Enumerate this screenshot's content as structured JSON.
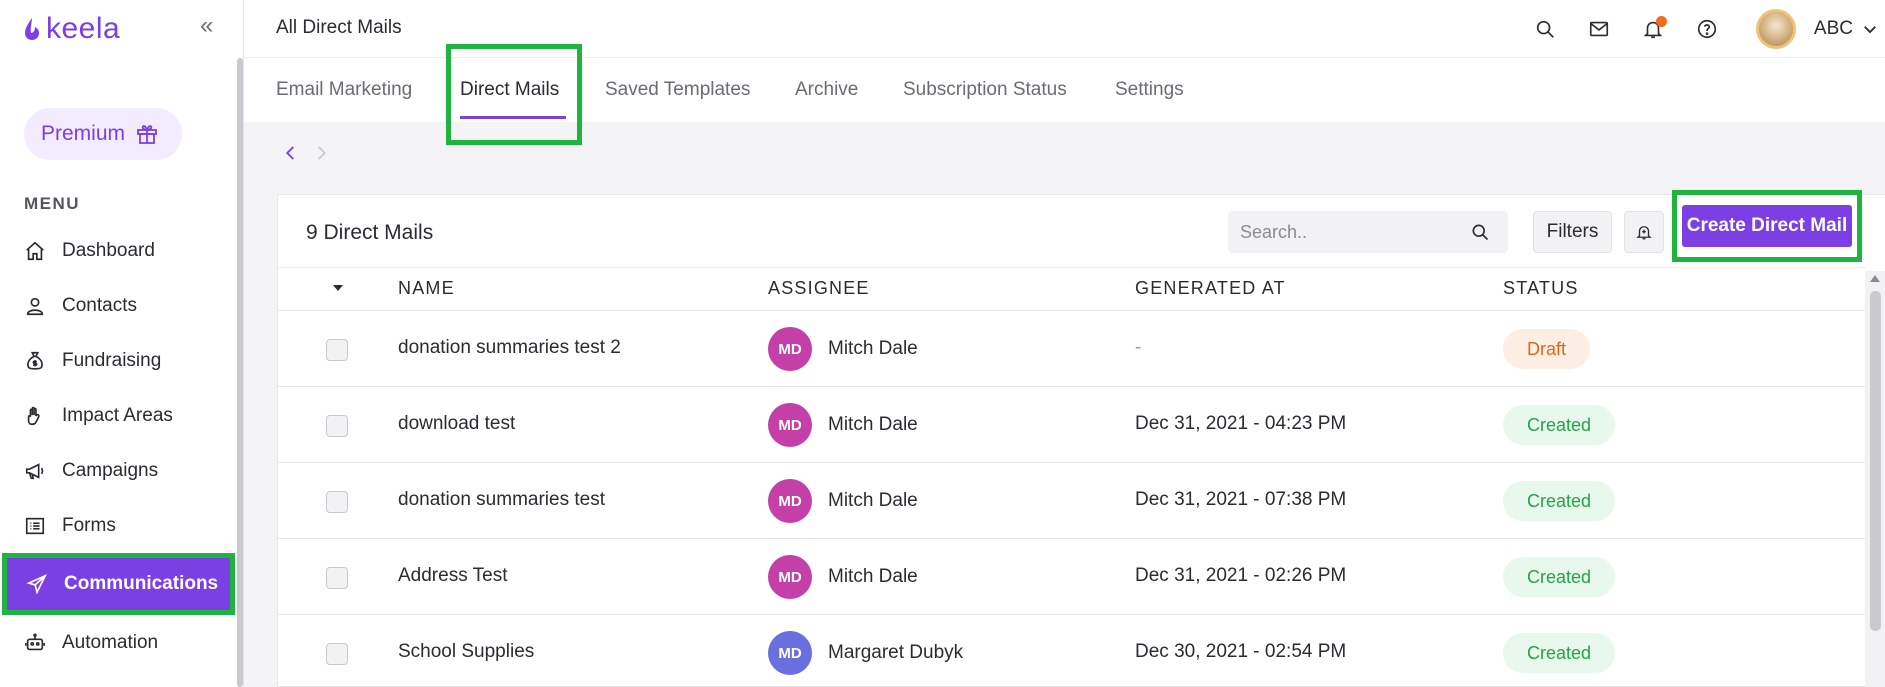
{
  "sidebar": {
    "logo_text": "keela",
    "premium_label": "Premium",
    "menu_title": "MENU",
    "items": [
      {
        "label": "Dashboard",
        "icon": "home-icon"
      },
      {
        "label": "Contacts",
        "icon": "user-icon"
      },
      {
        "label": "Fundraising",
        "icon": "money-bag-icon"
      },
      {
        "label": "Impact Areas",
        "icon": "hand-icon"
      },
      {
        "label": "Campaigns",
        "icon": "megaphone-icon"
      },
      {
        "label": "Forms",
        "icon": "form-icon"
      },
      {
        "label": "Communications",
        "icon": "paper-plane-icon",
        "active": true
      },
      {
        "label": "Automation",
        "icon": "robot-icon"
      }
    ]
  },
  "header": {
    "title": "All Direct Mails",
    "user_name": "ABC"
  },
  "tabs": [
    {
      "label": "Email Marketing"
    },
    {
      "label": "Direct Mails",
      "active": true
    },
    {
      "label": "Saved Templates"
    },
    {
      "label": "Archive"
    },
    {
      "label": "Subscription Status"
    },
    {
      "label": "Settings"
    }
  ],
  "card": {
    "title": "9 Direct Mails",
    "search_placeholder": "Search..",
    "filters_label": "Filters",
    "create_label": "Create Direct Mail"
  },
  "table": {
    "columns": [
      "NAME",
      "ASSIGNEE",
      "GENERATED AT",
      "STATUS"
    ],
    "rows": [
      {
        "name": "donation summaries test 2",
        "initials": "MD",
        "assignee": "Mitch Dale",
        "generated_at": "-",
        "status": "Draft"
      },
      {
        "name": "download test",
        "initials": "MD",
        "assignee": "Mitch Dale",
        "generated_at": "Dec 31, 2021 - 04:23 PM",
        "status": "Created"
      },
      {
        "name": "donation summaries test",
        "initials": "MD",
        "assignee": "Mitch Dale",
        "generated_at": "Dec 31, 2021 - 07:38 PM",
        "status": "Created"
      },
      {
        "name": "Address Test",
        "initials": "MD",
        "assignee": "Mitch Dale",
        "generated_at": "Dec 31, 2021 - 02:26 PM",
        "status": "Created"
      },
      {
        "name": "School Supplies",
        "initials": "MD",
        "assignee": "Margaret Dubyk",
        "generated_at": "Dec 30, 2021 - 02:54 PM",
        "status": "Created"
      }
    ]
  },
  "colors": {
    "brand": "#7b3fe4",
    "highlight": "#1fb33f",
    "avatar_mitch": "#c440a8",
    "avatar_margaret": "#6a6fe0",
    "draft": "#e0651c",
    "created": "#22a447"
  }
}
